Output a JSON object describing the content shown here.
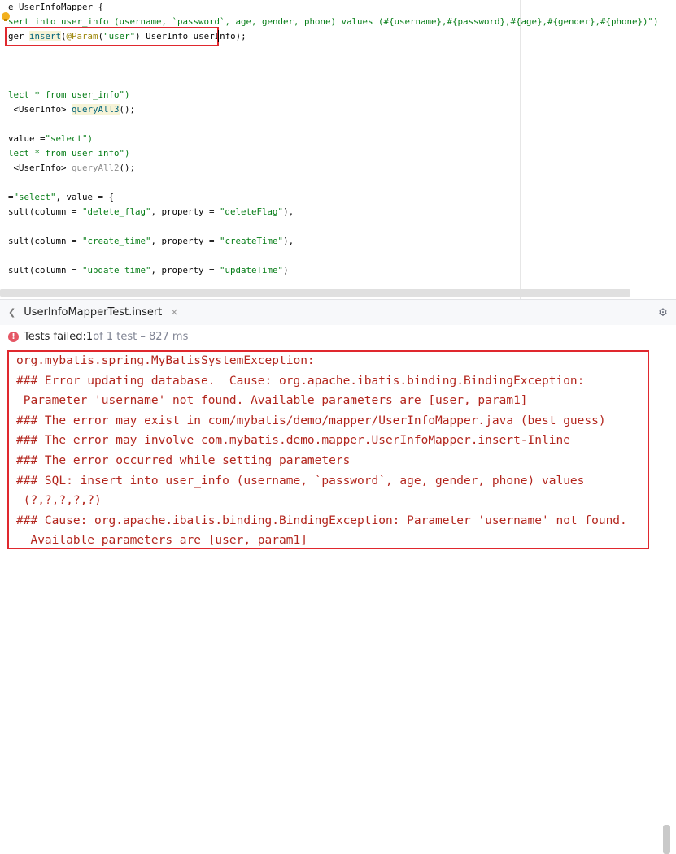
{
  "editor": {
    "lines": [
      [
        {
          "t": "e ",
          "c": ""
        },
        {
          "t": "UserInfoMapper {",
          "c": ""
        }
      ],
      [
        {
          "t": "sert into user_info (username, `password`, age, gender, phone) values (#{username},#{password},#{age},#{gender},#{phone})\")",
          "c": "st"
        }
      ],
      [
        {
          "t": "ger ",
          "c": ""
        },
        {
          "t": "insert",
          "c": "mt hl"
        },
        {
          "t": "(",
          "c": ""
        },
        {
          "t": "@Param",
          "c": "an"
        },
        {
          "t": "(",
          "c": ""
        },
        {
          "t": "\"user\"",
          "c": "st"
        },
        {
          "t": ") UserInfo userInfo",
          "c": ""
        },
        {
          "t": ");",
          "c": ""
        }
      ],
      [],
      [],
      [],
      [
        {
          "t": "lect * from user_info\")",
          "c": "st"
        }
      ],
      [
        {
          "t": " <UserInfo> ",
          "c": ""
        },
        {
          "t": "queryAll3",
          "c": "mt hl"
        },
        {
          "t": "();",
          "c": ""
        }
      ],
      [],
      [
        {
          "t": "value =",
          "c": ""
        },
        {
          "t": "\"select\")",
          "c": "st"
        }
      ],
      [
        {
          "t": "lect * from user_info\")",
          "c": "st"
        }
      ],
      [
        {
          "t": " <UserInfo> ",
          "c": ""
        },
        {
          "t": "queryAll2",
          "c": "gr"
        },
        {
          "t": "();",
          "c": ""
        }
      ],
      [],
      [
        {
          "t": "=",
          "c": ""
        },
        {
          "t": "\"select\"",
          "c": "st"
        },
        {
          "t": ", value = {",
          "c": ""
        }
      ],
      [
        {
          "t": "sult(column = ",
          "c": ""
        },
        {
          "t": "\"delete_flag\"",
          "c": "st"
        },
        {
          "t": ", property = ",
          "c": ""
        },
        {
          "t": "\"deleteFlag\"",
          "c": "st"
        },
        {
          "t": "),",
          "c": ""
        }
      ],
      [],
      [
        {
          "t": "sult(column = ",
          "c": ""
        },
        {
          "t": "\"create_time\"",
          "c": "st"
        },
        {
          "t": ", property = ",
          "c": ""
        },
        {
          "t": "\"createTime\"",
          "c": "st"
        },
        {
          "t": "),",
          "c": ""
        }
      ],
      [],
      [
        {
          "t": "sult(column = ",
          "c": ""
        },
        {
          "t": "\"update_time\"",
          "c": "st"
        },
        {
          "t": ", property = ",
          "c": ""
        },
        {
          "t": "\"updateTime\"",
          "c": "st"
        },
        {
          "t": ")",
          "c": ""
        }
      ]
    ]
  },
  "run_tab": {
    "label": "UserInfoMapperTest.insert",
    "close": "×",
    "chevron": "❮"
  },
  "status": {
    "icon": "!",
    "failed_label": "Tests failed: ",
    "failed_count": "1",
    "of_total": " of 1 test – 827 ms"
  },
  "output": {
    "lines": [
      "org.mybatis.spring.MyBatisSystemException:",
      "### Error updating database.  Cause: org.apache.ibatis.binding.BindingException:",
      " Parameter 'username' not found. Available parameters are [user, param1]",
      "### The error may exist in com/mybatis/demo/mapper/UserInfoMapper.java (best guess)",
      "### The error may involve com.mybatis.demo.mapper.UserInfoMapper.insert-Inline",
      "### The error occurred while setting parameters",
      "### SQL: insert into user_info (username, `password`, age, gender, phone) values",
      " (?,?,?,?,?)",
      "### Cause: org.apache.ibatis.binding.BindingException: Parameter 'username' not found.",
      "  Available parameters are [user, param1]"
    ]
  },
  "icons": {
    "gear": "⚙",
    "intention": "lightbulb-icon"
  },
  "colors": {
    "highlight_box": "#e0282e",
    "error_text": "#b3261e",
    "fail_icon": "#e55765",
    "string": "#067d17",
    "method": "#00627a",
    "annotation": "#9e880d"
  }
}
